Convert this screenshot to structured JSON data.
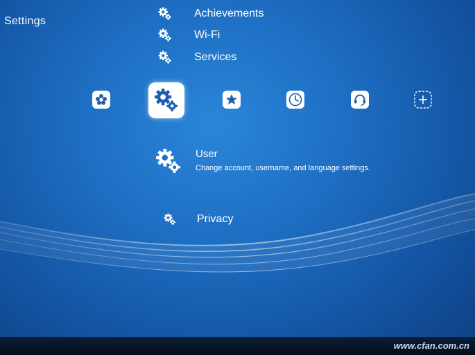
{
  "section_title": "Settings",
  "menu_above": [
    {
      "label": "Achievements",
      "icon": "gears-icon"
    },
    {
      "label": "Wi-Fi",
      "icon": "gears-icon"
    },
    {
      "label": "Services",
      "icon": "gears-icon"
    }
  ],
  "categories": [
    {
      "name": "main-menu-icon"
    },
    {
      "name": "settings-gears-icon",
      "active": true
    },
    {
      "name": "favorites-star-icon"
    },
    {
      "name": "history-clock-icon"
    },
    {
      "name": "netplay-headset-icon"
    },
    {
      "name": "add-plus-icon"
    }
  ],
  "selected_item": {
    "title": "User",
    "description": "Change account, username, and language settings."
  },
  "menu_below": [
    {
      "label": "Privacy",
      "icon": "gears-icon"
    }
  ],
  "watermark": "www.cfan.com.cn",
  "colors": {
    "background": "#1e6fc4",
    "text": "#ffffff",
    "active_tile": "#ffffff",
    "active_icon": "#1e5fae"
  }
}
